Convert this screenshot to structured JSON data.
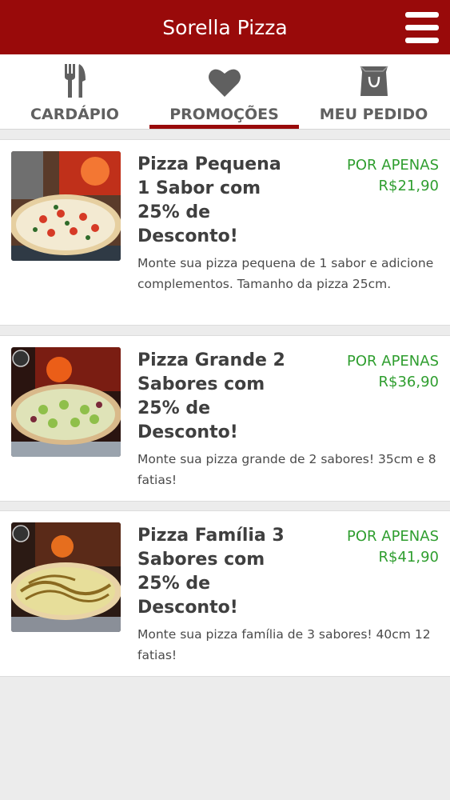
{
  "app": {
    "title": "Sorella Pizza"
  },
  "tabs": [
    {
      "label": "CARDÁPIO",
      "icon": "fork-knife-icon",
      "active": false
    },
    {
      "label": "PROMOÇÕES",
      "icon": "heart-icon",
      "active": true
    },
    {
      "label": "MEU PEDIDO",
      "icon": "shopping-bag-icon",
      "active": false
    }
  ],
  "promotions": [
    {
      "title": "Pizza Pequena 1 Sabor com 25% de Desconto!",
      "price_label": "POR APENAS",
      "price": "R$21,90",
      "description": "Monte sua pizza pequena de 1 sabor e adicione complementos. Tamanho da pizza 25cm."
    },
    {
      "title": "Pizza Grande 2 Sabores com 25% de Desconto!",
      "price_label": "POR APENAS",
      "price": "R$36,90",
      "description": "Monte sua pizza grande de 2 sabores! 35cm e 8 fatias!"
    },
    {
      "title": "Pizza Família 3 Sabores com 25% de Desconto!",
      "price_label": "POR APENAS",
      "price": "R$41,90",
      "description": "Monte sua pizza família de 3 sabores! 40cm 12 fatias!"
    }
  ],
  "colors": {
    "brand": "#990a0a",
    "price": "#2f9e2f",
    "background": "#ececec"
  }
}
